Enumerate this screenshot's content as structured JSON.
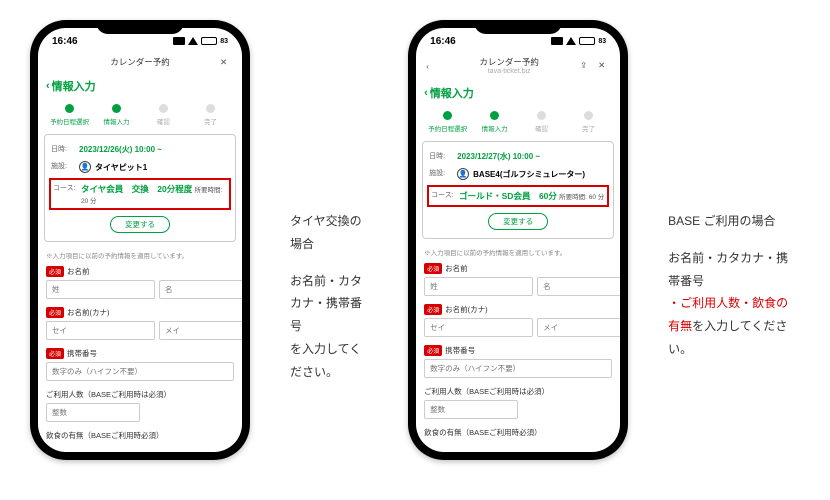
{
  "statusbar": {
    "time": "16:46",
    "battery": "83"
  },
  "titlebar": {
    "title": "カレンダー予約",
    "subtitle": "tava-ticket.biz"
  },
  "breadcrumb": "情報入力",
  "steps": [
    "予約日程選択",
    "情報入力",
    "確認",
    "完了"
  ],
  "card_labels": {
    "date": "日時:",
    "facility": "施設:",
    "course": "コース:"
  },
  "change_button": "変更する",
  "note": "※入力項目に以前の予約情報を適用しています。",
  "form": {
    "name_label": "お名前",
    "kana_label": "お名前(カナ)",
    "phone_label": "携帯番号",
    "guests_label": "ご利用人数（BASEご利用時は必須）",
    "food_label": "飲食の有無（BASEご利用時必須）",
    "required": "必須",
    "ph_sei": "姓",
    "ph_mei": "名",
    "ph_seik": "セイ",
    "ph_meik": "メイ",
    "ph_phone": "数字のみ（ハイフン不要）",
    "ph_count": "整数"
  },
  "phones": [
    {
      "date": "2023/12/26(火) 10:00 ~",
      "facility": "タイヤピット1",
      "course_main": "タイヤ会員　交換　20分程度",
      "course_tail": "所要時間: 20 分",
      "show_share": false
    },
    {
      "date": "2023/12/27(水) 10:00 ~",
      "facility": "BASE4(ゴルフシミュレーター)",
      "course_main": "ゴールド・SD会員　60分",
      "course_tail": "所要時間: 60 分",
      "show_share": true
    }
  ],
  "captions": [
    {
      "heading": "タイヤ交換の場合",
      "line1": "お名前・カタカナ・携帯番号",
      "line2_plain": "を入力してください。",
      "line2_red": ""
    },
    {
      "heading": "BASE ご利用の場合",
      "line1": "お名前・カタカナ・携帯番号",
      "line2_red": "・ご利用人数・飲食の有無",
      "line2_plain": "を入力してください。"
    }
  ]
}
